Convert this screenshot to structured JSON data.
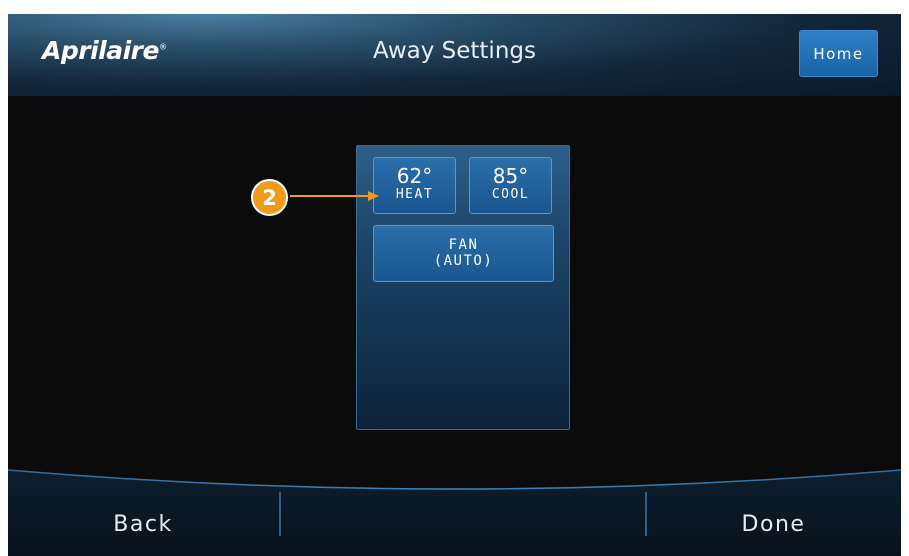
{
  "header": {
    "brand": "Aprilaire",
    "brand_mark": "®",
    "title": "Away Settings",
    "home_label": "Home"
  },
  "panel": {
    "heat": {
      "value": "62°",
      "label": "HEAT"
    },
    "cool": {
      "value": "85°",
      "label": "COOL"
    },
    "fan": {
      "label": "FAN",
      "mode": "(AUTO)"
    }
  },
  "callout": {
    "number": "2"
  },
  "footer": {
    "back_label": "Back",
    "done_label": "Done"
  },
  "colors": {
    "accent_blue": "#1f6db3",
    "callout_orange": "#f29a1a",
    "background": "#0b0b0c"
  }
}
